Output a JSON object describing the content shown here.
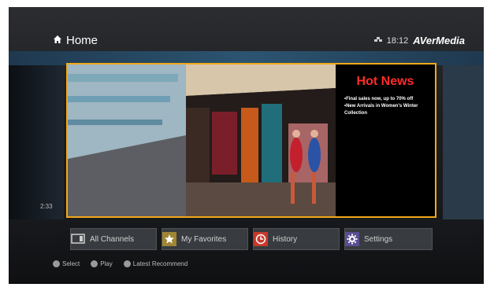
{
  "header": {
    "title": "Home",
    "time": "18:12",
    "brand": "AVerMedia"
  },
  "side": {
    "time_left": "2:33"
  },
  "feature": {
    "title": "Hot News",
    "items": [
      "•Final sales now, up to 70% off",
      "•New Arrivals in Women's Winter Collection"
    ]
  },
  "menu": [
    {
      "label": "All Channels",
      "icon": "tv-icon",
      "accent": "#6d6f75"
    },
    {
      "label": "My Favorites",
      "icon": "star-icon",
      "accent": "#a08535"
    },
    {
      "label": "History",
      "icon": "history-icon",
      "accent": "#c8392c"
    },
    {
      "label": "Settings",
      "icon": "gear-icon",
      "accent": "#5a4d91"
    }
  ],
  "hints": {
    "select": "Select",
    "play": "Play",
    "latest": "Latest Recommend"
  },
  "colors": {
    "focus_border": "#f0a81a",
    "hot_news": "#ff2b2b",
    "band": "#2f6488"
  }
}
